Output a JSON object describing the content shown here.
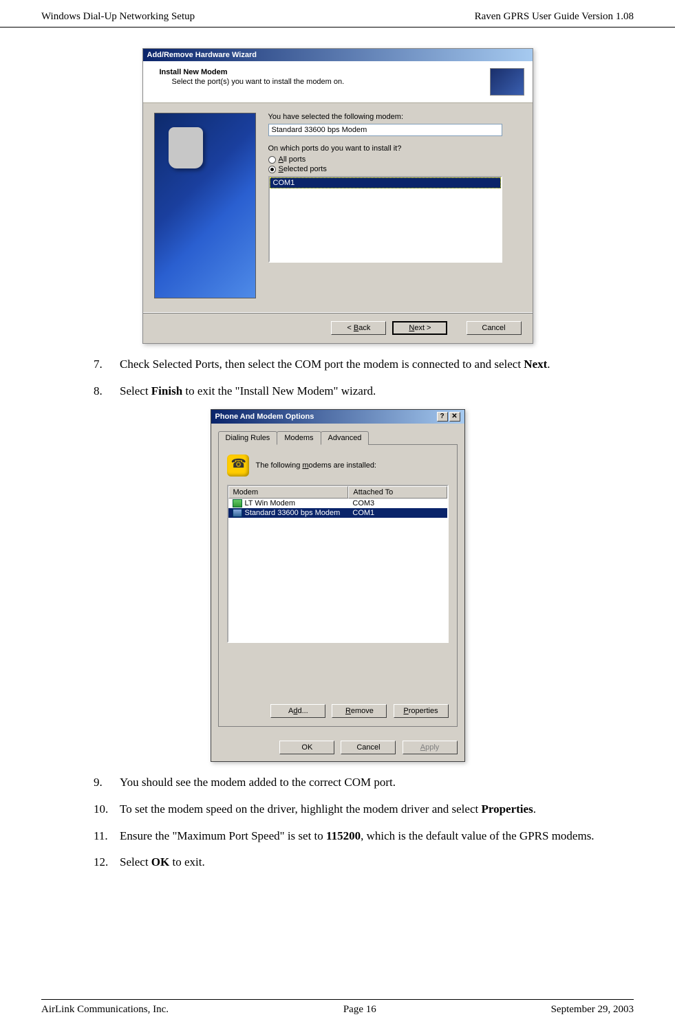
{
  "header": {
    "left": "Windows Dial-Up Networking Setup",
    "right": "Raven GPRS User Guide Version 1.08"
  },
  "footer": {
    "left": "AirLink Communications, Inc.",
    "center": "Page 16",
    "right": "September 29, 2003"
  },
  "wizard": {
    "titlebar": "Add/Remove Hardware Wizard",
    "heading": "Install New Modem",
    "subheading": "Select the port(s) you want to install the modem on.",
    "selected_prompt": "You have selected the following modem:",
    "modem_name": "Standard 33600 bps Modem",
    "ports_prompt": "On which ports do you want to install it?",
    "radio_all": "All ports",
    "radio_selected": "Selected ports",
    "port_item": "COM1",
    "btn_back": "< Back",
    "btn_next": "Next >",
    "btn_cancel": "Cancel"
  },
  "steps": {
    "n7": "7.",
    "s7a": "Check Selected Ports, then select the COM port the modem is connected to and select ",
    "s7b": "Next",
    "s7c": ".",
    "n8": "8.",
    "s8a": "Select ",
    "s8b": "Finish",
    "s8c": " to exit the \"Install New Modem\" wizard.",
    "n9": "9.",
    "s9": "You should see the modem added to the correct COM port.",
    "n10": "10.",
    "s10a": "To set the modem speed on the driver, highlight the modem driver and select ",
    "s10b": "Properties",
    "s10c": ".",
    "n11": "11.",
    "s11a": "Ensure the \"Maximum Port Speed\" is set to ",
    "s11b": "115200",
    "s11c": ", which is the default value of the GPRS modems.",
    "n12": "12.",
    "s12a": "Select ",
    "s12b": "OK",
    "s12c": " to exit."
  },
  "pmo": {
    "titlebar": "Phone And Modem Options",
    "help_btn": "?",
    "close_btn": "✕",
    "tabs": [
      "Dialing Rules",
      "Modems",
      "Advanced"
    ],
    "info": "The following modems are  installed:",
    "col1": "Modem",
    "col2": "Attached To",
    "rows": [
      {
        "name": "LT Win Modem",
        "port": "COM3"
      },
      {
        "name": "Standard 33600 bps Modem",
        "port": "COM1"
      }
    ],
    "btn_add": "Add...",
    "btn_remove": "Remove",
    "btn_properties": "Properties",
    "btn_ok": "OK",
    "btn_cancel": "Cancel",
    "btn_apply": "Apply"
  }
}
